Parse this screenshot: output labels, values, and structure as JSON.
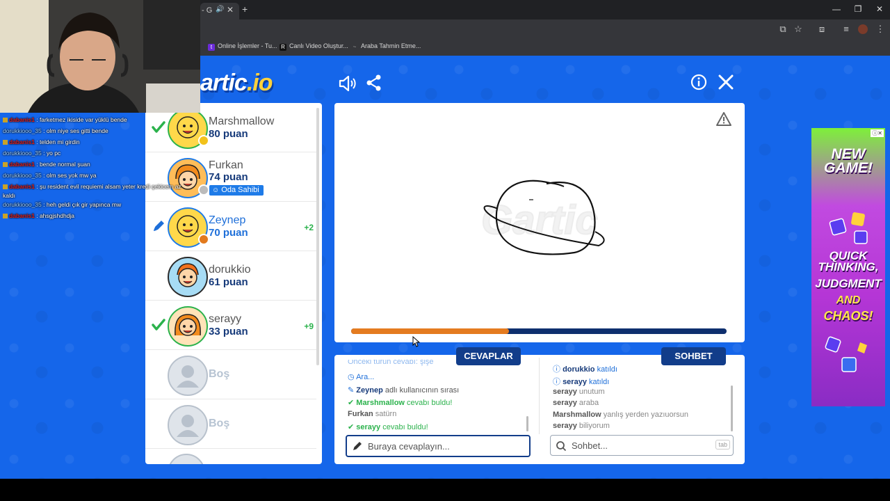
{
  "browser": {
    "tab_title": "- G",
    "bookmarks": [
      {
        "label": "Online İşlemler - Tu...",
        "icon": "t"
      },
      {
        "label": "Canlı Video Oluştur...",
        "icon": "R"
      },
      {
        "label": "Araba Tahmin Etme...",
        "icon": "~"
      }
    ]
  },
  "stream_chat": [
    {
      "user": "dabanis1",
      "text": " : farketmez ikiside var yüklü bende",
      "color": "red"
    },
    {
      "user": "dorukkiooo_35",
      "text": " : olm niye ses gitti bende",
      "color": "blue"
    },
    {
      "user": "dabanis1",
      "text": " : telden mi girdin",
      "color": "red"
    },
    {
      "user": "dorukkiooo_35",
      "text": " : yo pc",
      "color": "blue"
    },
    {
      "user": "dabanis1",
      "text": " : bende normal şuan",
      "color": "red"
    },
    {
      "user": "dorukkiooo_35",
      "text": " : olm ses yok mw ya",
      "color": "blue"
    },
    {
      "user": "dabanis1",
      "text": " : şu resident evil requiemi alsam yeter kredi çekicem az",
      "color": "red"
    },
    {
      "user": "",
      "text": "kaldı",
      "color": "plain"
    },
    {
      "user": "dorukkiooo_35",
      "text": " : heh geldi çık gir yapınca mw",
      "color": "blue"
    },
    {
      "user": "dabanis1",
      "text": " : ahsgjshdhdja",
      "color": "red"
    }
  ],
  "logo": {
    "text": "artic",
    "suffix": ".io"
  },
  "players": [
    {
      "name": "Marshmallow",
      "score": "80 puan",
      "status": "guessed",
      "bonus": ""
    },
    {
      "name": "Furkan",
      "score": "74 puan",
      "status": "owner",
      "bonus": "",
      "badge": "Oda Sahibi"
    },
    {
      "name": "Zeynep",
      "score": "70 puan",
      "status": "drawing",
      "bonus": "+2"
    },
    {
      "name": "dorukkio",
      "score": "61 puan",
      "status": "",
      "bonus": ""
    },
    {
      "name": "serayy",
      "score": "33 puan",
      "status": "guessed",
      "bonus": "+9"
    },
    {
      "name": "Boş",
      "score": "",
      "status": "empty",
      "bonus": ""
    },
    {
      "name": "Boş",
      "score": "",
      "status": "empty",
      "bonus": ""
    }
  ],
  "round_progress": 0.42,
  "answers": {
    "tab_label": "CEVAPLAR",
    "messages": [
      {
        "icon": "",
        "bold": "",
        "text": "Önceki turun cevabı: şişe",
        "style": "faded"
      },
      {
        "icon": "clock",
        "bold": "",
        "text": "Ara...",
        "style": "blue"
      },
      {
        "icon": "pencil",
        "bold": "Zeynep",
        "text": " adlı kullanıcının sırası",
        "style": "normal"
      },
      {
        "icon": "check",
        "bold": "Marshmallow",
        "text": " cevabı buldu!",
        "style": "green"
      },
      {
        "icon": "",
        "bold": "Furkan",
        "text": " satürn",
        "style": "gray"
      },
      {
        "icon": "check",
        "bold": "serayy",
        "text": " cevabı buldu!",
        "style": "green"
      }
    ],
    "input_placeholder": "Buraya cevaplayın..."
  },
  "chat": {
    "tab_label": "SOHBET",
    "messages": [
      {
        "icon": "info",
        "bold": "dorukkio",
        "text": " katıldı"
      },
      {
        "icon": "info",
        "bold": "serayy",
        "text": " katıldı"
      },
      {
        "icon": "",
        "bold": "serayy",
        "text": " unutum"
      },
      {
        "icon": "",
        "bold": "serayy",
        "text": " araba"
      },
      {
        "icon": "",
        "bold": "Marshmallow",
        "text": " yanlış yerden yazıuorsun"
      },
      {
        "icon": "",
        "bold": "serayy",
        "text": " biliyorum"
      }
    ],
    "input_placeholder": "Sohbet...",
    "tab_hint": "tab"
  },
  "ad": {
    "headline": "NEW GAME!",
    "tagline_1": "QUICK THINKING,",
    "tagline_2": "JUDGMENT",
    "tagline_3": "AND",
    "tagline_4": "CHAOS!"
  }
}
